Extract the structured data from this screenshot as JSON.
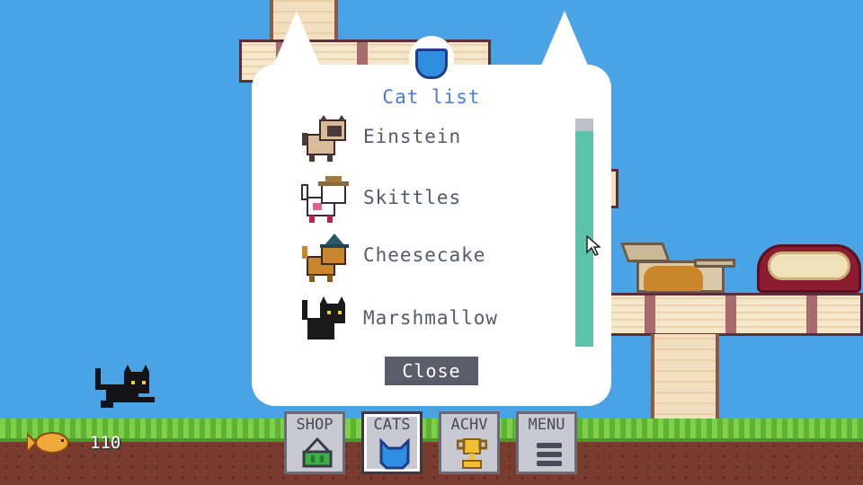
{
  "modal": {
    "title": "Cat list",
    "cats": [
      {
        "name": "Einstein",
        "colors": {
          "body": "#d8bc9a",
          "face": "#4a3a3a"
        }
      },
      {
        "name": "Skittles",
        "colors": {
          "body": "#ffffff",
          "spots": "#e06090",
          "hat": "#8a6a3a"
        }
      },
      {
        "name": "Cheesecake",
        "colors": {
          "body": "#c9862a",
          "hat": "#2a5a6a"
        }
      },
      {
        "name": "Marshmallow",
        "colors": {
          "body": "#1a1a1a",
          "eyes": "#e8d040"
        }
      }
    ],
    "close_label": "Close"
  },
  "hud": {
    "coins": "110",
    "buttons": [
      {
        "label": "SHOP",
        "icon": "basket-icon"
      },
      {
        "label": "CATS",
        "icon": "cat-head-icon",
        "active": true
      },
      {
        "label": "ACHV",
        "icon": "trophy-icon"
      },
      {
        "label": "MENU",
        "icon": "hamburger-menu-icon"
      }
    ]
  },
  "colors": {
    "sky": "#4aa3e4",
    "title": "#4a7ae0",
    "scrollbar": "#5cc2aa",
    "close_button": "#5c5c6a"
  }
}
